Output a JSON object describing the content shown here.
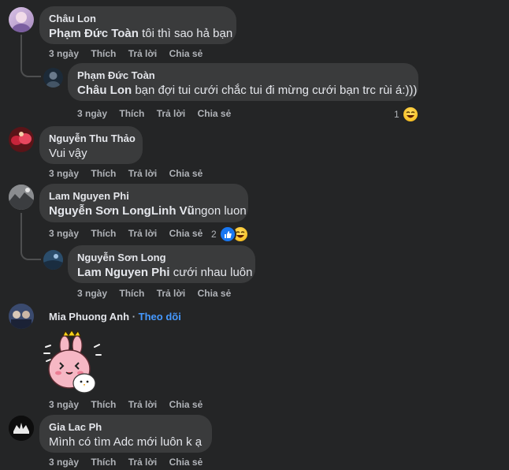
{
  "comments": [
    {
      "author": "Châu Lon",
      "mention": "Phạm Đức Toàn",
      "text": " tôi thì sao hả bạn",
      "time": "3 ngày"
    },
    {
      "author": "Phạm Đức Toàn",
      "mention": "Châu Lon",
      "text": " bạn đợi tui cưới chắc tui đi mừng cưới bạn trc rùi á:)))",
      "time": "3 ngày",
      "reaction_count": "1"
    },
    {
      "author": "Nguyễn Thu Thảo",
      "text": "Vui vậy",
      "time": "3 ngày"
    },
    {
      "author": "Lam Nguyen Phi",
      "mention": "Nguyễn Sơn LongLinh Vũ",
      "text": "ngon luon",
      "time": "3 ngày",
      "reaction_count": "2"
    },
    {
      "author": "Nguyễn Sơn Long",
      "mention": "Lam Nguyen Phi",
      "text": " cưới nhau luôn",
      "time": "3 ngày"
    },
    {
      "author": "Mia Phuong Anh",
      "follow": "Theo dõi",
      "separator": "·",
      "time": "3 ngày"
    },
    {
      "author": "Gia Lac Ph",
      "text": "Mình có tìm Adc mới luôn k ạ",
      "time": "3 ngày"
    }
  ],
  "actions": {
    "like": "Thích",
    "reply": "Trả lời",
    "share": "Chia sẻ"
  },
  "colors": {
    "background": "#242526",
    "bubble": "#3a3b3c",
    "secondary_text": "#b0b3b8",
    "link": "#4599ff"
  },
  "icons": {
    "haha": "haha-reaction-icon",
    "like": "like-reaction-icon",
    "sticker": "bunny-sticker"
  }
}
